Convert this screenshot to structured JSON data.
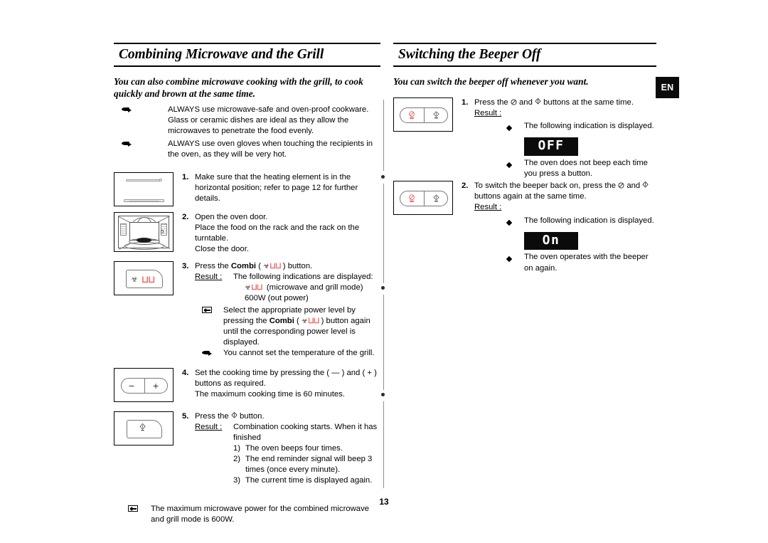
{
  "document": {
    "page_number": "13",
    "language_badge": "EN"
  },
  "left_column": {
    "heading": "Combining Microwave and the Grill",
    "intro": "You can also combine microwave cooking with the grill, to cook quickly and brown at the same time.",
    "warnings": [
      {
        "icon": "hand-pointer-icon",
        "text": "ALWAYS use microwave-safe and oven-proof cookware. Glass or ceramic dishes are ideal as they allow the microwaves to penetrate the food evenly."
      },
      {
        "icon": "hand-pointer-icon",
        "text": "ALWAYS use oven gloves when touching the recipients in the oven, as they will be very hot."
      }
    ],
    "steps": [
      {
        "number": "1.",
        "figure": "heating-element-horizontal",
        "lines": [
          "Make sure that the heating element is in the horizontal position; refer to page 12 for further details."
        ]
      },
      {
        "number": "2.",
        "figure": "oven-interior-rack",
        "lines": [
          "Open the oven door.",
          "Place the food on the rack and the rack on the turntable.",
          "Close the door."
        ]
      },
      {
        "number": "3.",
        "figure": "combi-button",
        "lead_pre": "Press the ",
        "lead_bold": "Combi",
        "lead_post": " button.",
        "result_label": "Result :",
        "result_text": "The following indications are displayed:",
        "result_items": [
          "(microwave and grill mode)",
          "600W (out power)"
        ],
        "notes": [
          {
            "icon": "microwave-note-icon",
            "text_pre": "Select the appropriate power level by pressing the ",
            "text_bold": "Combi",
            "text_post": " button again until the corresponding power level is displayed."
          },
          {
            "icon": "hand-pointer-icon",
            "text": "You cannot set the temperature of the grill."
          }
        ]
      },
      {
        "number": "4.",
        "figure": "minus-plus-buttons",
        "lines": [
          "Set the cooking time by pressing the ( — ) and ( + ) buttons as required.",
          "The maximum cooking time is 60 minutes."
        ]
      },
      {
        "number": "5.",
        "figure": "start-button",
        "lead_pre": "Press the ",
        "lead_post": " button.",
        "result_label": "Result :",
        "result_text": "Combination cooking starts. When it has finished",
        "sub_items": [
          {
            "n": "1)",
            "t": "The oven beeps four times."
          },
          {
            "n": "2)",
            "t": "The end reminder signal will beep 3 times (once every minute)."
          },
          {
            "n": "3)",
            "t": "The current time is displayed again."
          }
        ]
      }
    ],
    "footer_note": {
      "icon": "microwave-note-icon",
      "text": "The maximum microwave power for the combined microwave and grill mode is 600W."
    }
  },
  "right_column": {
    "heading": "Switching the Beeper Off",
    "intro": "You can switch the beeper off whenever you want.",
    "steps": [
      {
        "number": "1.",
        "figure": "stop-start-buttons",
        "lead_pre": "Press the ",
        "lead_mid": " and ",
        "lead_post": " buttons at the same time.",
        "result_label": "Result :",
        "bullets": [
          {
            "text": "The following indication is displayed."
          },
          {
            "text": "The oven does not beep each time you press a button."
          }
        ],
        "lcd": "OFF"
      },
      {
        "number": "2.",
        "figure": "stop-start-buttons",
        "lead_pre": "To switch the beeper back on, press the ",
        "lead_mid": " and ",
        "lead_post": " buttons again at the same time.",
        "result_label": "Result :",
        "bullets": [
          {
            "text": "The following indication is displayed."
          },
          {
            "text": "The oven operates with the beeper on again."
          }
        ],
        "lcd": "On"
      }
    ]
  }
}
